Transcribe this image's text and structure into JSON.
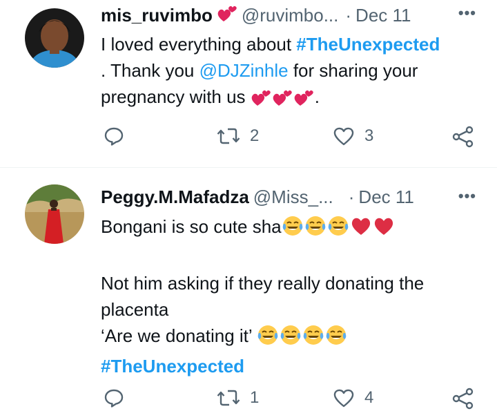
{
  "tweets": [
    {
      "name": "mis_ruvimbo",
      "handle": "@ruvimbo...",
      "separator": "·",
      "date": "Dec 11",
      "more": "•••",
      "text_1a": "I loved everything about ",
      "hashtag": "#TheUnexpected",
      "text_2a": ". Thank you ",
      "mention": "@DJZinhle",
      "text_2b": " for sharing your",
      "text_3a": "pregnancy with us ",
      "text_3b": ".",
      "replies": "",
      "retweets": "2",
      "likes": "3"
    },
    {
      "name": "Peggy.M.Mafadza",
      "handle": "@Miss_...",
      "separator": "·",
      "date": "Dec 11",
      "more": "•••",
      "line_1": "Bongani is so cute sha",
      "line_2": "Not him asking if they really donating the",
      "line_3": "placenta",
      "line_4": "‘Are we donating it’ ",
      "hashtag": "#TheUnexpected",
      "replies": "",
      "retweets": "1",
      "likes": "4"
    }
  ],
  "colors": {
    "accent": "#1d9bf0",
    "muted": "#536471",
    "heart": "#e0245e"
  },
  "icons": [
    "two-hearts-icon",
    "reply-icon",
    "retweet-icon",
    "like-icon",
    "share-icon",
    "more-icon",
    "tears-of-joy-emoji",
    "red-heart-emoji"
  ]
}
